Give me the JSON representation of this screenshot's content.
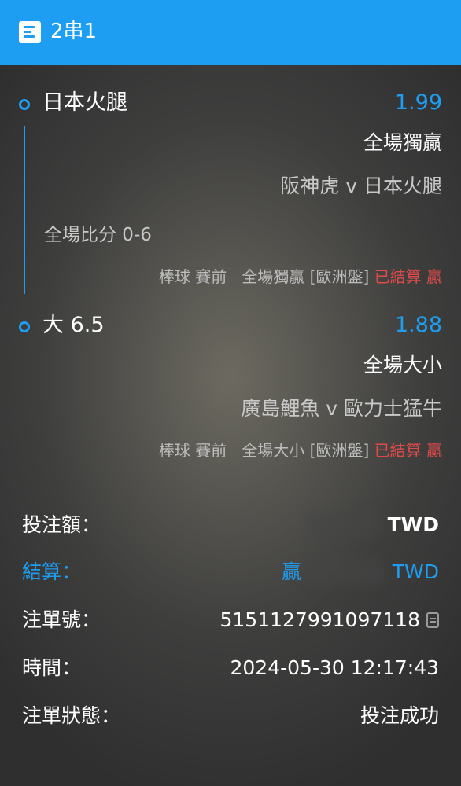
{
  "header": {
    "title": "2串1",
    "icon": "document-icon",
    "color": "#1e9ef2"
  },
  "legs": [
    {
      "selection": "日本火腿",
      "odds": "1.99",
      "market": "全場獨贏",
      "match": "阪神虎 v 日本火腿",
      "score": "全場比分 0-6",
      "sport": "棒球",
      "period": "賽前",
      "bet_type": "全場獨贏 [歐洲盤]",
      "status": "已結算",
      "result": "贏"
    },
    {
      "selection": "大 6.5",
      "odds": "1.88",
      "market": "全場大小",
      "match": "廣島鯉魚 v 歐力士猛牛",
      "sport": "棒球",
      "period": "賽前",
      "bet_type": "全場大小 [歐洲盤]",
      "status": "已結算",
      "result": "贏"
    }
  ],
  "details": {
    "stake_label": "投注額：",
    "stake_currency": "TWD",
    "settlement_label": "結算：",
    "settlement_result": "贏",
    "settlement_currency": "TWD",
    "ticket_label": "注單號：",
    "ticket_no": "5151127991097118",
    "time_label": "時間：",
    "time_value": "2024-05-30 12:17:43",
    "status_label": "注單狀態：",
    "status_value": "投注成功"
  },
  "colors": {
    "accent": "#1e9ef2",
    "win": "#e24a4a"
  }
}
